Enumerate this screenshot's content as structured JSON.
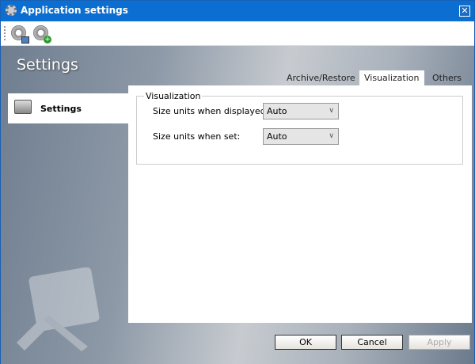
{
  "window": {
    "title": "Application settings",
    "close_label": "✕"
  },
  "toolbar": {
    "buttons": [
      {
        "icon": "gear-save-icon"
      },
      {
        "icon": "gear-add-icon"
      }
    ]
  },
  "sidebar": {
    "heading": "Settings",
    "items": [
      {
        "label": "Settings",
        "icon": "briefcase-icon",
        "selected": true
      }
    ]
  },
  "tabs": [
    {
      "label": "Archive/Restore",
      "active": false
    },
    {
      "label": "Visualization",
      "active": true
    },
    {
      "label": "Others",
      "active": false
    }
  ],
  "visualization": {
    "group_title": "Visualization",
    "fields": [
      {
        "label": "Size units when displayed:",
        "value": "Auto"
      },
      {
        "label": "Size units when set:",
        "value": "Auto"
      }
    ]
  },
  "footer": {
    "ok": "OK",
    "cancel": "Cancel",
    "apply": "Apply"
  }
}
